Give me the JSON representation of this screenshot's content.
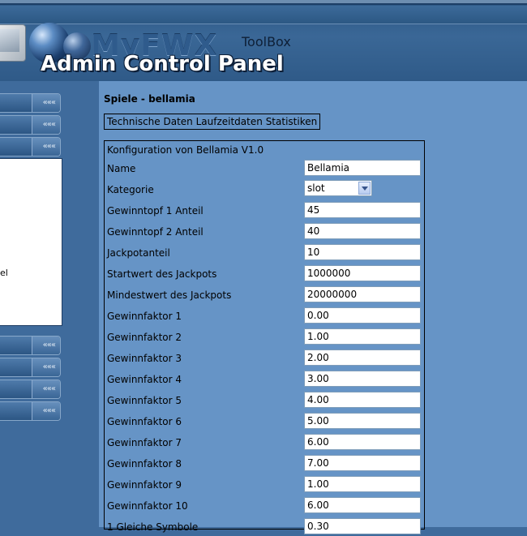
{
  "header": {
    "brand": "MyFWX",
    "toolbox": "ToolBox",
    "panel_title": "Admin Control Panel"
  },
  "sidebar": {
    "chevron": "«««",
    "submenu_fragment": "el"
  },
  "content": {
    "heading": "Spiele - bellamia",
    "tabs": [
      "Technische Daten",
      "Laufzeitdaten",
      "Statistiken"
    ],
    "config_title": "Konfiguration von Bellamia V1.0",
    "fields": [
      {
        "label": "Name",
        "value": "Bellamia",
        "type": "text"
      },
      {
        "label": "Kategorie",
        "value": "slot",
        "type": "select"
      },
      {
        "label": "Gewinntopf 1 Anteil",
        "value": "45",
        "type": "text"
      },
      {
        "label": "Gewinntopf 2 Anteil",
        "value": "40",
        "type": "text"
      },
      {
        "label": "Jackpotanteil",
        "value": "10",
        "type": "text"
      },
      {
        "label": "Startwert des Jackpots",
        "value": "1000000",
        "type": "text"
      },
      {
        "label": "Mindestwert des Jackpots",
        "value": "20000000",
        "type": "text"
      },
      {
        "label": "Gewinnfaktor 1",
        "value": "0.00",
        "type": "text"
      },
      {
        "label": "Gewinnfaktor 2",
        "value": "1.00",
        "type": "text"
      },
      {
        "label": "Gewinnfaktor 3",
        "value": "2.00",
        "type": "text"
      },
      {
        "label": "Gewinnfaktor 4",
        "value": "3.00",
        "type": "text"
      },
      {
        "label": "Gewinnfaktor 5",
        "value": "4.00",
        "type": "text"
      },
      {
        "label": "Gewinnfaktor 6",
        "value": "5.00",
        "type": "text"
      },
      {
        "label": "Gewinnfaktor 7",
        "value": "6.00",
        "type": "text"
      },
      {
        "label": "Gewinnfaktor 8",
        "value": "7.00",
        "type": "text"
      },
      {
        "label": "Gewinnfaktor 9",
        "value": "1.00",
        "type": "text"
      },
      {
        "label": "Gewinnfaktor 10",
        "value": "6.00",
        "type": "text"
      },
      {
        "label": "1 Gleiche Symbole",
        "value": "0.30",
        "type": "text"
      }
    ]
  }
}
